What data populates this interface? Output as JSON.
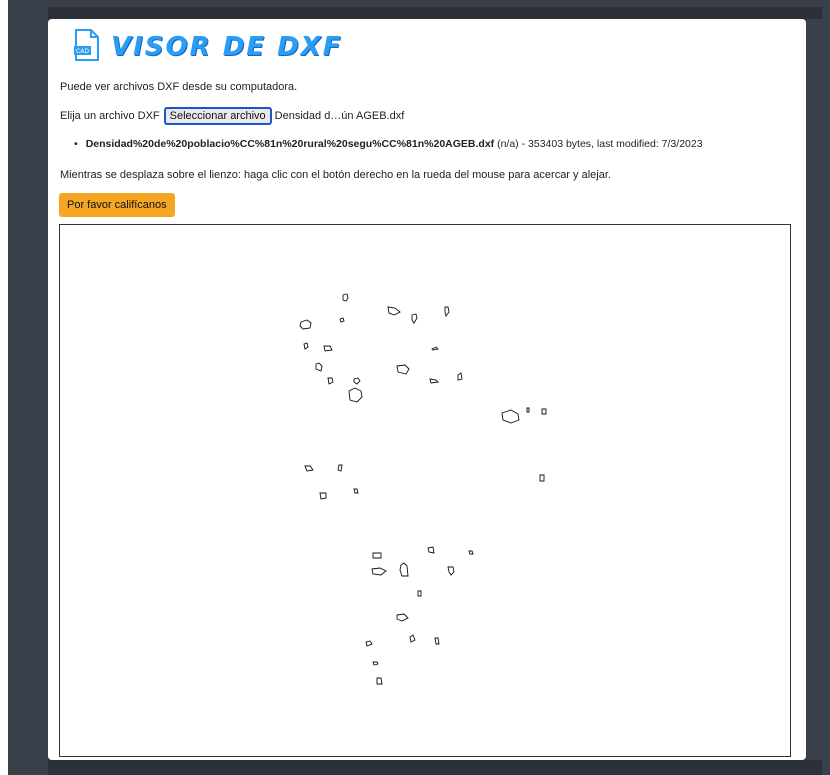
{
  "app": {
    "title": "VISOR DE DXF",
    "logo_label": "CAD"
  },
  "intro_text": "Puede ver archivos DXF desde su computadora.",
  "file_input": {
    "label": "Elija un archivo DXF",
    "button_label": "Seleccionar archivo",
    "chosen_file": "Densidad d…ún AGEB.dxf"
  },
  "file_info": {
    "name": "Densidad%20de%20poblacio%CC%81n%20rural%20segu%CC%81n%20AGEB.dxf",
    "details": " (n/a) - 353403 bytes, last modified: 7/3/2023"
  },
  "hint_text": "Mientras se desplaza sobre el lienzo: haga clic con el botón derecho en la rueda del mouse para acercar y alejar.",
  "rate_button_label": "Por favor califícanos",
  "colors": {
    "accent": "#2a9df4",
    "rate_button": "#f5a623",
    "frame": "#3a4049"
  },
  "icons": {
    "logo": "cad-file-icon"
  }
}
